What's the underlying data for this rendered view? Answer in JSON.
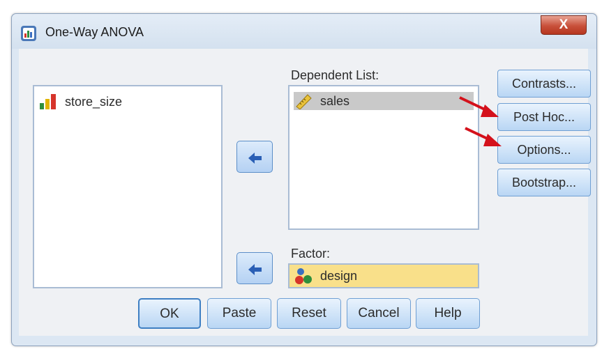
{
  "window": {
    "title": "One-Way ANOVA",
    "close_label": "X"
  },
  "variables_list": {
    "items": [
      {
        "label": "store_size",
        "icon": "ordinal-bar-icon"
      }
    ]
  },
  "dependent_list": {
    "label": "Dependent List:",
    "items": [
      {
        "label": "sales",
        "icon": "scale-ruler-icon",
        "selected": true
      }
    ]
  },
  "factor": {
    "label": "Factor:",
    "value": "design",
    "icon": "nominal-people-icon",
    "highlight_color": "#f9e08a"
  },
  "side_buttons": {
    "contrasts": "Contrasts...",
    "post_hoc": "Post Hoc...",
    "options": "Options...",
    "bootstrap": "Bootstrap..."
  },
  "bottom_buttons": {
    "ok": "OK",
    "paste": "Paste",
    "reset": "Reset",
    "cancel": "Cancel",
    "help": "Help"
  },
  "colors": {
    "annotation_arrow": "#d4111b",
    "button_blue": "#b9d6f4"
  }
}
